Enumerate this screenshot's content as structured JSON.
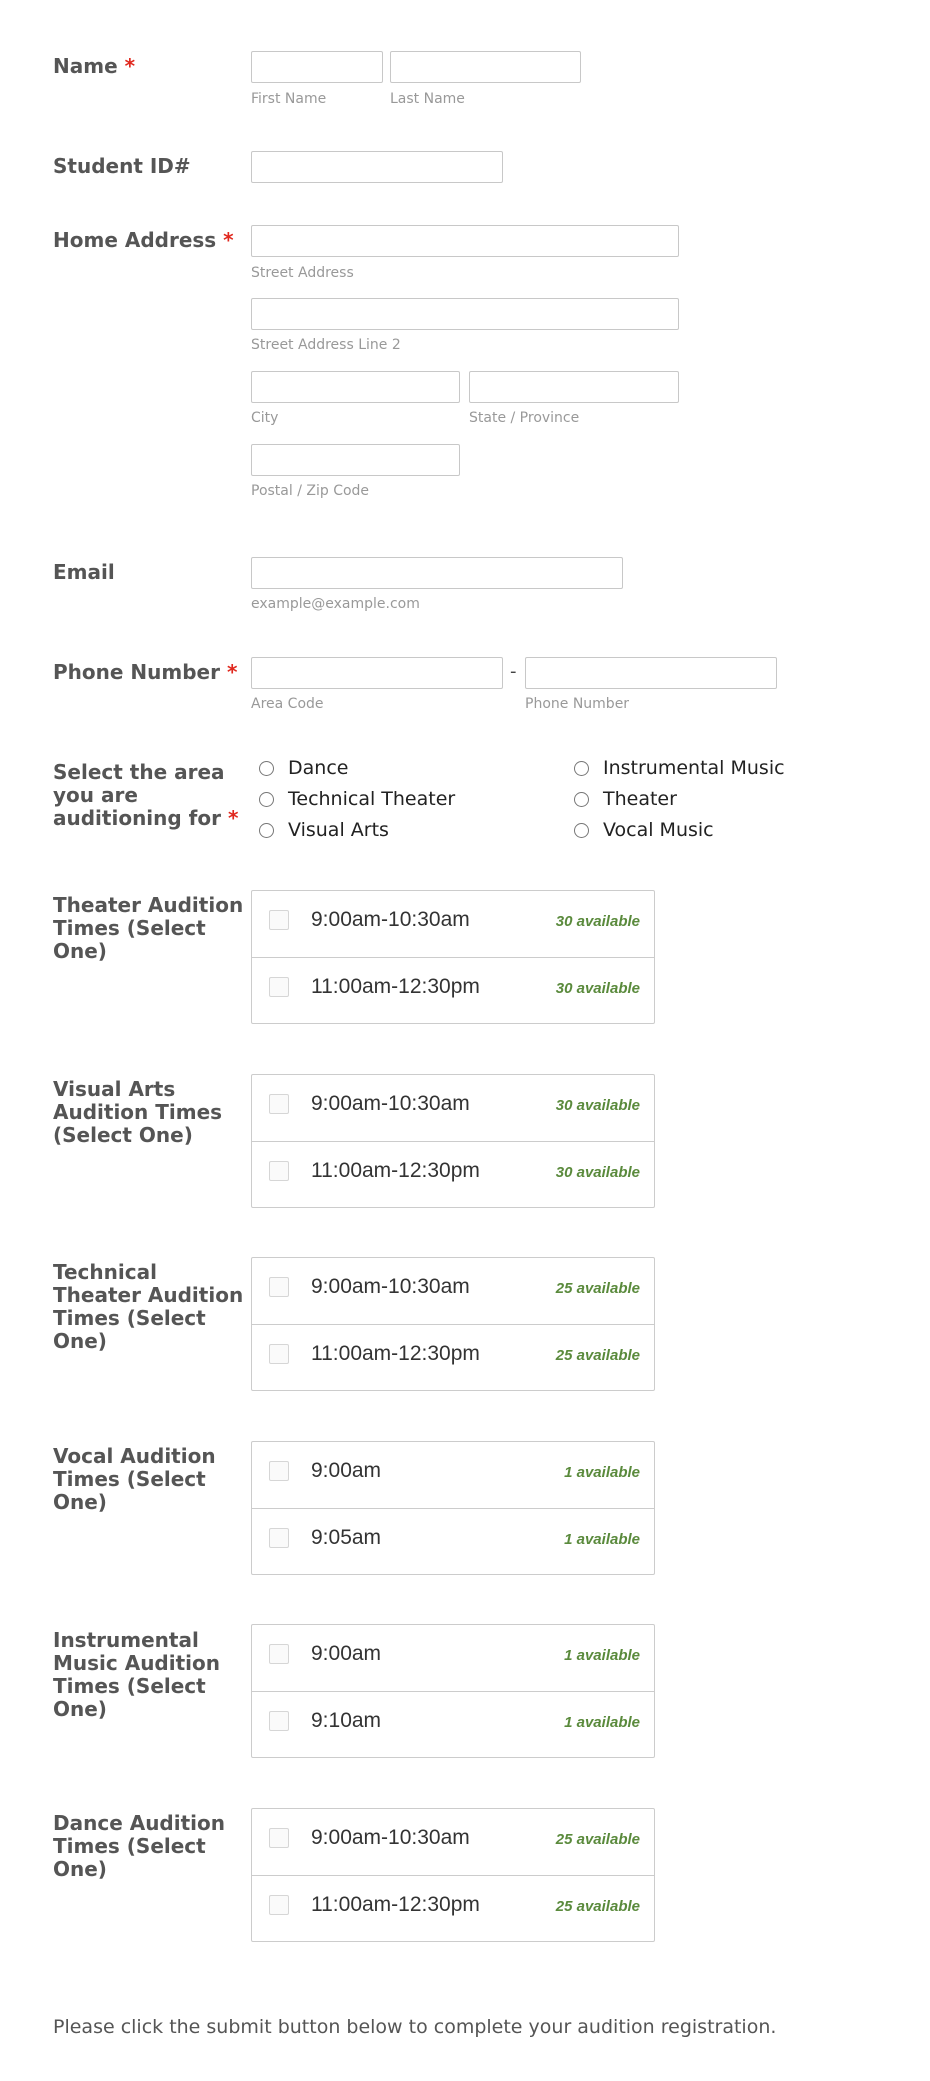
{
  "name": {
    "label": "Name",
    "required": "*",
    "first_sub": "First Name",
    "last_sub": "Last Name"
  },
  "student_id": {
    "label": "Student ID#"
  },
  "address": {
    "label": "Home Address",
    "required": "*",
    "street_sub": "Street Address",
    "street2_sub": "Street Address Line 2",
    "city_sub": "City",
    "state_sub": "State / Province",
    "zip_sub": "Postal / Zip Code"
  },
  "email": {
    "label": "Email",
    "sub": "example@example.com"
  },
  "phone": {
    "label": "Phone Number",
    "required": "*",
    "separator": "-",
    "area_sub": "Area Code",
    "number_sub": "Phone Number"
  },
  "area": {
    "label": "Select the area you are auditioning for",
    "required": "*",
    "options": [
      "Dance",
      "Instrumental Music",
      "Technical Theater",
      "Theater",
      "Visual Arts",
      "Vocal Music"
    ]
  },
  "audition_groups": [
    {
      "label": "Theater Audition Times (Select One)",
      "slots": [
        {
          "time": "9:00am-10:30am",
          "avail": "30 available"
        },
        {
          "time": "11:00am-12:30pm",
          "avail": "30 available"
        }
      ]
    },
    {
      "label": "Visual Arts Audition Times (Select One)",
      "slots": [
        {
          "time": "9:00am-10:30am",
          "avail": "30 available"
        },
        {
          "time": "11:00am-12:30pm",
          "avail": "30 available"
        }
      ]
    },
    {
      "label": "Technical Theater Audition Times (Select One)",
      "slots": [
        {
          "time": "9:00am-10:30am",
          "avail": "25 available"
        },
        {
          "time": "11:00am-12:30pm",
          "avail": "25 available"
        }
      ]
    },
    {
      "label": "Vocal Audition Times (Select One)",
      "slots": [
        {
          "time": "9:00am",
          "avail": "1 available"
        },
        {
          "time": "9:05am",
          "avail": "1 available"
        }
      ]
    },
    {
      "label": "Instrumental Music Audition Times (Select One)",
      "slots": [
        {
          "time": "9:00am",
          "avail": "1 available"
        },
        {
          "time": "9:10am",
          "avail": "1 available"
        }
      ]
    },
    {
      "label": "Dance Audition Times (Select One)",
      "slots": [
        {
          "time": "9:00am-10:30am",
          "avail": "25 available"
        },
        {
          "time": "11:00am-12:30pm",
          "avail": "25 available"
        }
      ]
    }
  ],
  "footer": {
    "text": "Please click the submit button below to complete your audition registration."
  },
  "colors": {
    "required": "#e0281e",
    "available": "#5a8a3c",
    "label": "#555555",
    "border": "#c8c8c8"
  }
}
